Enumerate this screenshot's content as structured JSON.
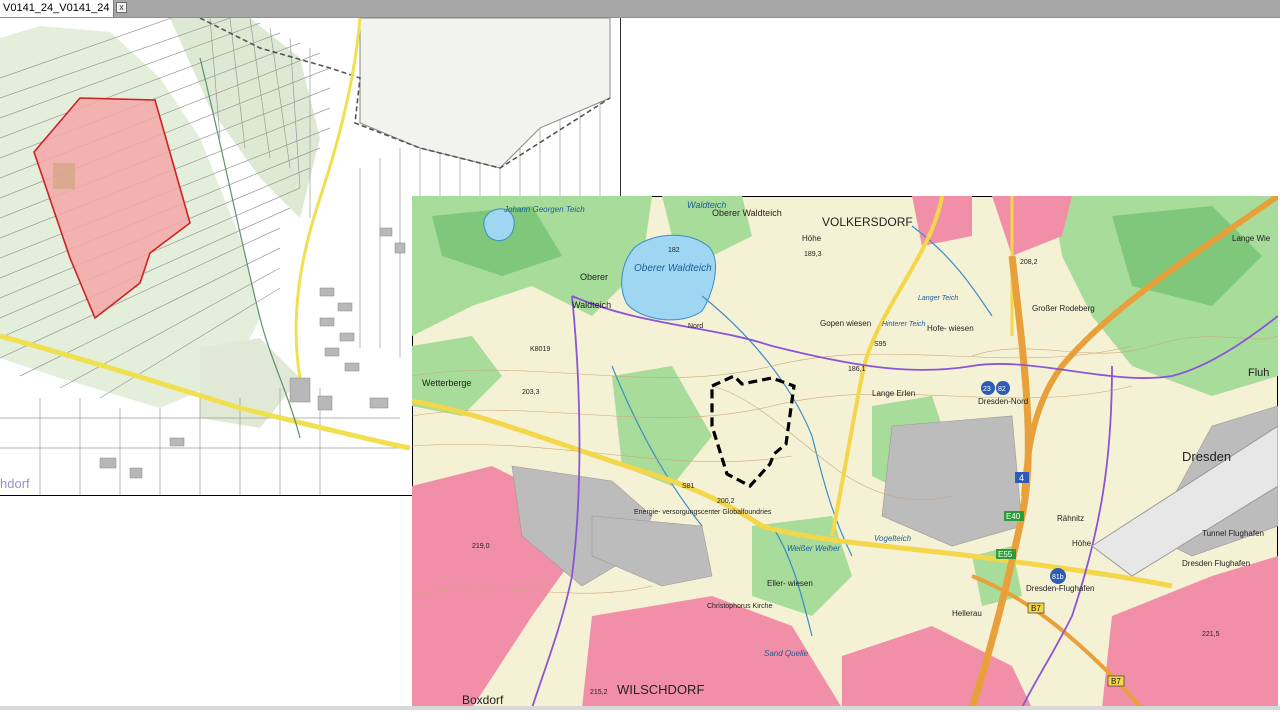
{
  "window": {
    "tab_title": "V0141_24_V0141_24",
    "close_glyph": "x"
  },
  "left_map": {
    "place_label": "hdorf",
    "colors": {
      "area_fill": "#f4a7a7",
      "area_stroke": "#cc2222",
      "road": "#f0e050",
      "forest": "#d7e6c8"
    }
  },
  "right_map": {
    "labels": {
      "volkersdorf": "VOLKERSDORF",
      "oberer_waldteich_lake": "Oberer Waldteich",
      "oberer_waldteich_top": "Oberer Waldteich",
      "waldteich": "Waldteich",
      "oberer": "Oberer",
      "waldteich_small": "Waldteich",
      "johann_georgen": "Johann Georgen Teich",
      "wetterberge": "Wetterberge",
      "dresden": "Dresden",
      "dresden_nord": "Dresden-Nord",
      "dresden_flughafen": "Dresden-Flughafen",
      "flughafen": "Dresden Flughafen",
      "tunnel": "Tunnel Flughafen",
      "wilschdorf": "WILSCHDORF",
      "boxdorf": "Boxdorf",
      "hellerau": "Hellerau",
      "lange_erlen": "Lange Erlen",
      "gopen_wiesen": "Gopen wiesen",
      "hofe_wiesen": "Hofe- wiesen",
      "grosser_rodeberg": "Großer Rodeberg",
      "energie": "Energie- versorgungscenter Globalfoundries",
      "ellerwiesen": "Eller- wiesen",
      "christophorus": "Christophorus Kirche",
      "sand_quelle": "Sand Quelle",
      "fluh": "Fluh",
      "lange_wie": "Lange Wie",
      "hohe_right": "Höhe",
      "hohe_top": "Höhe",
      "rahnitz": "Rähnitz",
      "vogelteich": "Vogelteich",
      "weiher": "Weißer Weiher",
      "hinterer_teich": "Hinterer Teich",
      "langer_teich": "Langer Teich",
      "nord_label": "Nord",
      "elev_203": "203,3",
      "elev_200": "200,2",
      "elev_189": "189,3",
      "elev_186": "186,1",
      "elev_182": "182",
      "elev_215": "215,2",
      "elev_219": "219,0",
      "elev_208": "208,2",
      "elev_221": "221,5",
      "road_s81": "S81",
      "road_s95": "S95",
      "road_a4": "4",
      "road_e40": "E40",
      "road_e55": "E55",
      "road_b7": "B7",
      "road_b7b": "B7",
      "road_k8019": "K8019",
      "exit_81b": "81b",
      "exit_8283": "82",
      "exit_23": "23"
    },
    "colors": {
      "base": "#f5f1d4",
      "forest": "#a8dc9a",
      "forest_dark": "#7fc77a",
      "water": "#9fd6f2",
      "urban": "#f28fa8",
      "industrial": "#bcbcbc",
      "motorway": "#e8a13a",
      "road": "#f4d64a",
      "boundary": "#8a55d6",
      "contour": "#c9a77a"
    }
  }
}
